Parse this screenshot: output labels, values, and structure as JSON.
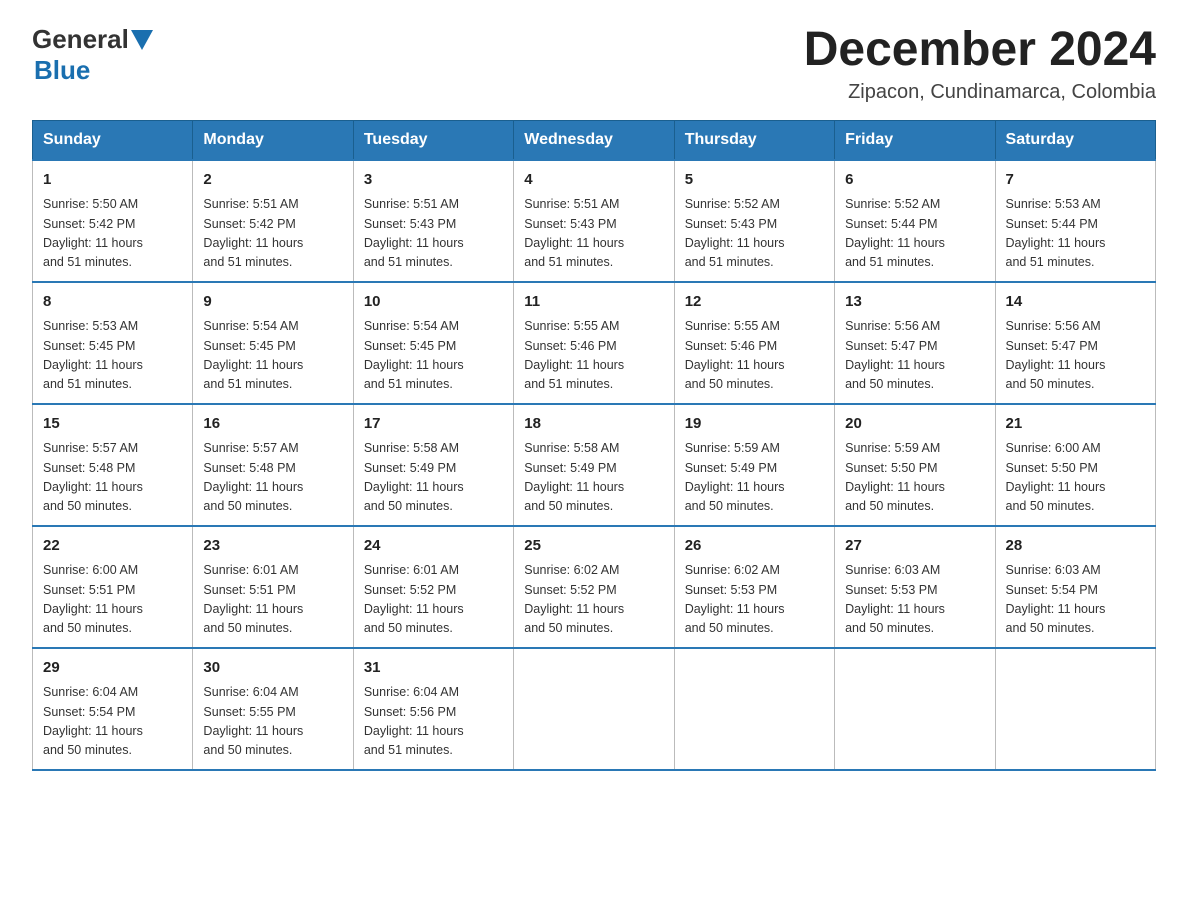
{
  "header": {
    "logo": {
      "general": "General",
      "blue": "Blue"
    },
    "title": "December 2024",
    "subtitle": "Zipacon, Cundinamarca, Colombia"
  },
  "days_of_week": [
    "Sunday",
    "Monday",
    "Tuesday",
    "Wednesday",
    "Thursday",
    "Friday",
    "Saturday"
  ],
  "weeks": [
    [
      {
        "day": "1",
        "sunrise": "5:50 AM",
        "sunset": "5:42 PM",
        "daylight": "11 hours and 51 minutes."
      },
      {
        "day": "2",
        "sunrise": "5:51 AM",
        "sunset": "5:42 PM",
        "daylight": "11 hours and 51 minutes."
      },
      {
        "day": "3",
        "sunrise": "5:51 AM",
        "sunset": "5:43 PM",
        "daylight": "11 hours and 51 minutes."
      },
      {
        "day": "4",
        "sunrise": "5:51 AM",
        "sunset": "5:43 PM",
        "daylight": "11 hours and 51 minutes."
      },
      {
        "day": "5",
        "sunrise": "5:52 AM",
        "sunset": "5:43 PM",
        "daylight": "11 hours and 51 minutes."
      },
      {
        "day": "6",
        "sunrise": "5:52 AM",
        "sunset": "5:44 PM",
        "daylight": "11 hours and 51 minutes."
      },
      {
        "day": "7",
        "sunrise": "5:53 AM",
        "sunset": "5:44 PM",
        "daylight": "11 hours and 51 minutes."
      }
    ],
    [
      {
        "day": "8",
        "sunrise": "5:53 AM",
        "sunset": "5:45 PM",
        "daylight": "11 hours and 51 minutes."
      },
      {
        "day": "9",
        "sunrise": "5:54 AM",
        "sunset": "5:45 PM",
        "daylight": "11 hours and 51 minutes."
      },
      {
        "day": "10",
        "sunrise": "5:54 AM",
        "sunset": "5:45 PM",
        "daylight": "11 hours and 51 minutes."
      },
      {
        "day": "11",
        "sunrise": "5:55 AM",
        "sunset": "5:46 PM",
        "daylight": "11 hours and 51 minutes."
      },
      {
        "day": "12",
        "sunrise": "5:55 AM",
        "sunset": "5:46 PM",
        "daylight": "11 hours and 50 minutes."
      },
      {
        "day": "13",
        "sunrise": "5:56 AM",
        "sunset": "5:47 PM",
        "daylight": "11 hours and 50 minutes."
      },
      {
        "day": "14",
        "sunrise": "5:56 AM",
        "sunset": "5:47 PM",
        "daylight": "11 hours and 50 minutes."
      }
    ],
    [
      {
        "day": "15",
        "sunrise": "5:57 AM",
        "sunset": "5:48 PM",
        "daylight": "11 hours and 50 minutes."
      },
      {
        "day": "16",
        "sunrise": "5:57 AM",
        "sunset": "5:48 PM",
        "daylight": "11 hours and 50 minutes."
      },
      {
        "day": "17",
        "sunrise": "5:58 AM",
        "sunset": "5:49 PM",
        "daylight": "11 hours and 50 minutes."
      },
      {
        "day": "18",
        "sunrise": "5:58 AM",
        "sunset": "5:49 PM",
        "daylight": "11 hours and 50 minutes."
      },
      {
        "day": "19",
        "sunrise": "5:59 AM",
        "sunset": "5:49 PM",
        "daylight": "11 hours and 50 minutes."
      },
      {
        "day": "20",
        "sunrise": "5:59 AM",
        "sunset": "5:50 PM",
        "daylight": "11 hours and 50 minutes."
      },
      {
        "day": "21",
        "sunrise": "6:00 AM",
        "sunset": "5:50 PM",
        "daylight": "11 hours and 50 minutes."
      }
    ],
    [
      {
        "day": "22",
        "sunrise": "6:00 AM",
        "sunset": "5:51 PM",
        "daylight": "11 hours and 50 minutes."
      },
      {
        "day": "23",
        "sunrise": "6:01 AM",
        "sunset": "5:51 PM",
        "daylight": "11 hours and 50 minutes."
      },
      {
        "day": "24",
        "sunrise": "6:01 AM",
        "sunset": "5:52 PM",
        "daylight": "11 hours and 50 minutes."
      },
      {
        "day": "25",
        "sunrise": "6:02 AM",
        "sunset": "5:52 PM",
        "daylight": "11 hours and 50 minutes."
      },
      {
        "day": "26",
        "sunrise": "6:02 AM",
        "sunset": "5:53 PM",
        "daylight": "11 hours and 50 minutes."
      },
      {
        "day": "27",
        "sunrise": "6:03 AM",
        "sunset": "5:53 PM",
        "daylight": "11 hours and 50 minutes."
      },
      {
        "day": "28",
        "sunrise": "6:03 AM",
        "sunset": "5:54 PM",
        "daylight": "11 hours and 50 minutes."
      }
    ],
    [
      {
        "day": "29",
        "sunrise": "6:04 AM",
        "sunset": "5:54 PM",
        "daylight": "11 hours and 50 minutes."
      },
      {
        "day": "30",
        "sunrise": "6:04 AM",
        "sunset": "5:55 PM",
        "daylight": "11 hours and 50 minutes."
      },
      {
        "day": "31",
        "sunrise": "6:04 AM",
        "sunset": "5:56 PM",
        "daylight": "11 hours and 51 minutes."
      },
      null,
      null,
      null,
      null
    ]
  ],
  "labels": {
    "sunrise": "Sunrise:",
    "sunset": "Sunset:",
    "daylight": "Daylight:"
  }
}
